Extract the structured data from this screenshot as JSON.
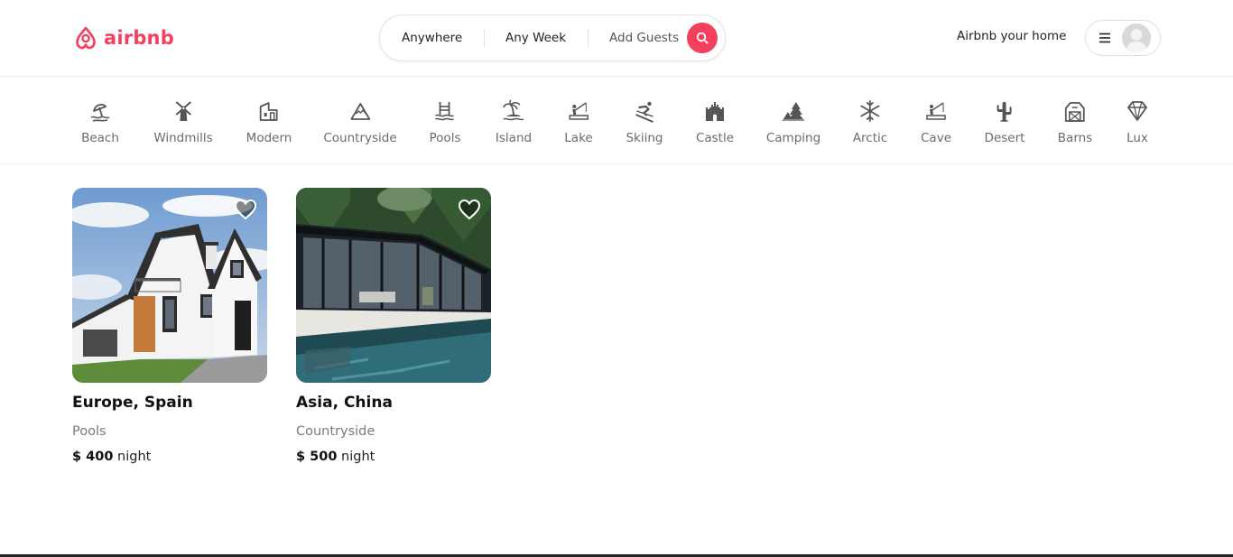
{
  "header": {
    "logo_text": "airbnb",
    "brand_color": "#f43f5e",
    "search": {
      "anywhere": "Anywhere",
      "any_week": "Any Week",
      "add_guests": "Add Guests"
    },
    "host_link": "Airbnb your home"
  },
  "categories": [
    {
      "label": "Beach",
      "icon": "beach-icon"
    },
    {
      "label": "Windmills",
      "icon": "windmill-icon"
    },
    {
      "label": "Modern",
      "icon": "modern-icon"
    },
    {
      "label": "Countryside",
      "icon": "mountain-icon"
    },
    {
      "label": "Pools",
      "icon": "pool-icon"
    },
    {
      "label": "Island",
      "icon": "island-icon"
    },
    {
      "label": "Lake",
      "icon": "lake-icon"
    },
    {
      "label": "Skiing",
      "icon": "skiing-icon"
    },
    {
      "label": "Castle",
      "icon": "castle-icon"
    },
    {
      "label": "Camping",
      "icon": "camping-icon"
    },
    {
      "label": "Arctic",
      "icon": "snowflake-icon"
    },
    {
      "label": "Cave",
      "icon": "cave-icon"
    },
    {
      "label": "Desert",
      "icon": "cactus-icon"
    },
    {
      "label": "Barns",
      "icon": "barn-icon"
    },
    {
      "label": "Lux",
      "icon": "diamond-icon"
    }
  ],
  "listings": [
    {
      "title": "Europe, Spain",
      "category": "Pools",
      "price": "$ 400",
      "unit": "night"
    },
    {
      "title": "Asia, China",
      "category": "Countryside",
      "price": "$ 500",
      "unit": "night"
    }
  ]
}
